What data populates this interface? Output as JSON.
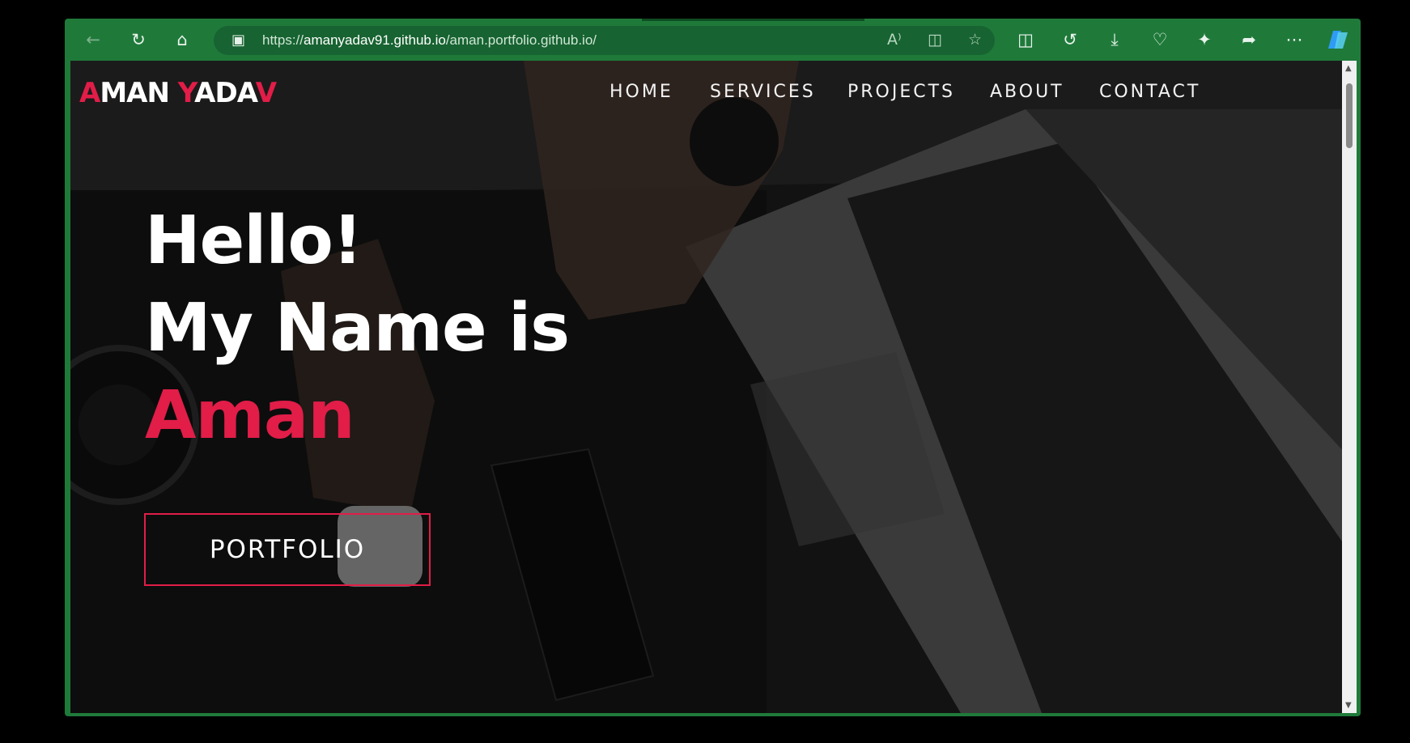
{
  "browser": {
    "url_prefix": "https://",
    "url_host": "amanyadav91.github.io",
    "url_path": "/aman.portfolio.github.io/",
    "toolbar_icons": [
      "back-icon",
      "refresh-icon",
      "home-icon",
      "lock-icon",
      "read-aloud-icon",
      "immersive-reader-icon",
      "favorite-star-icon",
      "split-screen-icon",
      "history-icon",
      "downloads-icon",
      "browser-essentials-icon",
      "extensions-icon",
      "share-icon",
      "more-icon",
      "copilot-icon"
    ],
    "accent_color": "#1f7a3a"
  },
  "site": {
    "logo_first_letter": "A",
    "logo_rest1": "MAN ",
    "logo_second_letter": "Y",
    "logo_rest2": "ADA",
    "logo_last_letter": "V",
    "nav": {
      "home": "HOME",
      "services": "SERVICES",
      "projects": "PROJECTS",
      "about": "ABOUT",
      "contact": "CONTACT"
    },
    "hero": {
      "line1": "Hello!",
      "line2": "My Name is",
      "name": "Aman"
    },
    "cta_label": "PORTFOLIO",
    "brand_color": "#e11d48"
  }
}
